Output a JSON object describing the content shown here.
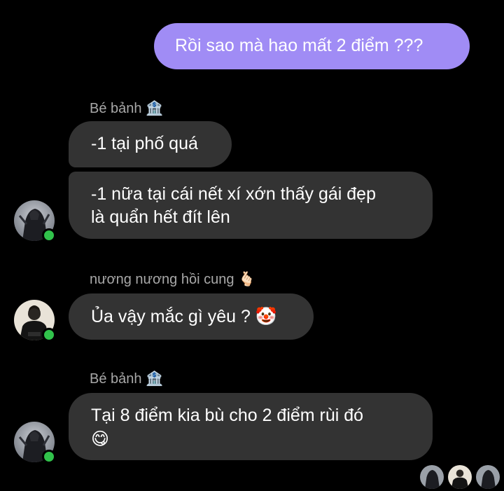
{
  "colors": {
    "background": "#000000",
    "outgoing_bubble": "#a08cf5",
    "incoming_bubble": "#333333",
    "sender_name": "#a8a8a8",
    "online_dot": "#31c24b"
  },
  "messages": {
    "outgoing_1": "Rồi sao mà hao mất 2 điểm ???",
    "group_1": {
      "sender": "Bé bảnh",
      "sender_emoji": "🏦",
      "bubble_1": "-1 tại phố quá",
      "bubble_2_line_1": "-1 nữa tại cái nết xí xớn thấy gái đẹp",
      "bubble_2_line_2": "là quẩn hết đít lên"
    },
    "group_2": {
      "sender": "nương nương hồi cung",
      "sender_emoji": "🫰🏻",
      "bubble_1_text": "Ủa vậy mắc gì yêu ?",
      "bubble_1_emoji": "🤡"
    },
    "group_3": {
      "sender": "Bé bảnh",
      "sender_emoji": "🏦",
      "bubble_1_line_1": "Tại 8 điểm kia bù cho 2 điểm rùi đó",
      "bubble_1_emoji": "😋"
    }
  },
  "icons": {
    "avatar_1": "avatar-dark-figure",
    "avatar_2": "avatar-person-black-jacket",
    "seen_receipts": [
      "avatar-dark-figure",
      "avatar-person-black-jacket",
      "avatar-dark-figure"
    ]
  }
}
